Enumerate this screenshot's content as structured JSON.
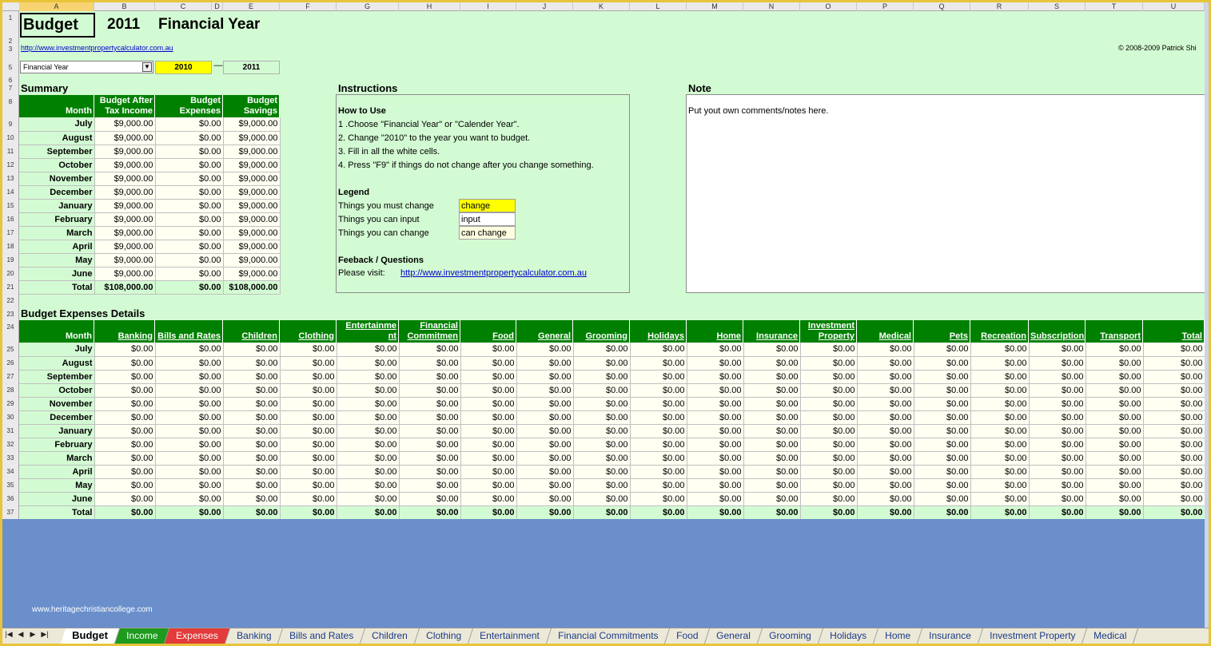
{
  "columns": [
    "A",
    "B",
    "C",
    "D",
    "E",
    "F",
    "G",
    "H",
    "I",
    "J",
    "K",
    "L",
    "M",
    "N",
    "O",
    "P",
    "Q",
    "R",
    "S",
    "T",
    "U"
  ],
  "rows": [
    "1",
    "2",
    "3",
    "5",
    "6",
    "7",
    "8",
    "9",
    "10",
    "11",
    "12",
    "13",
    "14",
    "15",
    "16",
    "17",
    "18",
    "19",
    "20",
    "21",
    "22",
    "23",
    "24",
    "25",
    "26",
    "27",
    "28",
    "29",
    "30",
    "31",
    "32",
    "33",
    "34",
    "35",
    "36",
    "37"
  ],
  "header": {
    "budget_label": "Budget",
    "year": "2011",
    "financial_year_label": "Financial Year",
    "website_link": "http://www.investmentpropertycalculator.com.au",
    "copyright": "© 2008-2009 Patrick Shi",
    "year_type_select": "Financial Year",
    "start_year": "2010",
    "separator": "—",
    "end_year": "2011"
  },
  "summary": {
    "title": "Summary",
    "headers": [
      "Month",
      "Budget After Tax Income",
      "Budget Expenses",
      "Budget Savings"
    ],
    "rows": [
      {
        "month": "July",
        "income": "$9,000.00",
        "expenses": "$0.00",
        "savings": "$9,000.00"
      },
      {
        "month": "August",
        "income": "$9,000.00",
        "expenses": "$0.00",
        "savings": "$9,000.00"
      },
      {
        "month": "September",
        "income": "$9,000.00",
        "expenses": "$0.00",
        "savings": "$9,000.00"
      },
      {
        "month": "October",
        "income": "$9,000.00",
        "expenses": "$0.00",
        "savings": "$9,000.00"
      },
      {
        "month": "November",
        "income": "$9,000.00",
        "expenses": "$0.00",
        "savings": "$9,000.00"
      },
      {
        "month": "December",
        "income": "$9,000.00",
        "expenses": "$0.00",
        "savings": "$9,000.00"
      },
      {
        "month": "January",
        "income": "$9,000.00",
        "expenses": "$0.00",
        "savings": "$9,000.00"
      },
      {
        "month": "February",
        "income": "$9,000.00",
        "expenses": "$0.00",
        "savings": "$9,000.00"
      },
      {
        "month": "March",
        "income": "$9,000.00",
        "expenses": "$0.00",
        "savings": "$9,000.00"
      },
      {
        "month": "April",
        "income": "$9,000.00",
        "expenses": "$0.00",
        "savings": "$9,000.00"
      },
      {
        "month": "May",
        "income": "$9,000.00",
        "expenses": "$0.00",
        "savings": "$9,000.00"
      },
      {
        "month": "June",
        "income": "$9,000.00",
        "expenses": "$0.00",
        "savings": "$9,000.00"
      }
    ],
    "total": {
      "month": "Total",
      "income": "$108,000.00",
      "expenses": "$0.00",
      "savings": "$108,000.00"
    }
  },
  "instructions": {
    "title": "Instructions",
    "how_to_use": "How to Use",
    "steps": [
      "1 .Choose \"Financial Year\" or \"Calender Year\".",
      "2. Change \"2010\" to the year you want to budget.",
      "3. Fill in all the white cells.",
      "4. Press \"F9\" if things do not change after you change something."
    ],
    "legend_title": "Legend",
    "legend": [
      {
        "label": "Things you must change",
        "sample": "change",
        "color": "#ffff00"
      },
      {
        "label": "Things you can input",
        "sample": "input",
        "color": "#ffffff"
      },
      {
        "label": "Things you can change",
        "sample": "can change",
        "color": "#ffffe0"
      }
    ],
    "feedback_title": "Feeback / Questions",
    "please_visit": "Please visit:",
    "feedback_link": "http://www.investmentpropertycalculator.com.au"
  },
  "note": {
    "title": "Note",
    "text": "Put yout own comments/notes here."
  },
  "details": {
    "title": "Budget Expenses Details",
    "month_header": "Month",
    "categories": [
      "Banking",
      "Bills and Rates",
      "Children",
      "Clothing",
      "Entertainme nt",
      "Financial Commitmen",
      "Food",
      "General",
      "Grooming",
      "Holidays",
      "Home",
      "Insurance",
      "Investment Property",
      "Medical",
      "Pets",
      "Recreation",
      "Subscriptions",
      "Transport",
      "Total"
    ],
    "months": [
      "July",
      "August",
      "September",
      "October",
      "November",
      "December",
      "January",
      "February",
      "March",
      "April",
      "May",
      "June"
    ],
    "cell_value": "$0.00",
    "total_label": "Total"
  },
  "sheet_tabs": [
    "Budget",
    "Income",
    "Expenses",
    "Banking",
    "Bills and Rates",
    "Children",
    "Clothing",
    "Entertainment",
    "Financial Commitments",
    "Food",
    "General",
    "Grooming",
    "Holidays",
    "Home",
    "Insurance",
    "Investment Property",
    "Medical"
  ],
  "tab_nav": [
    "|◀",
    "◀",
    "▶",
    "▶|"
  ],
  "watermark": "www.heritagechristiancollege.com",
  "colors": {
    "sheet_bg": "#d3fbd3",
    "header_green": "#008000",
    "input_yellow": "#ffff00",
    "frame_blue": "#6a8fcb"
  }
}
